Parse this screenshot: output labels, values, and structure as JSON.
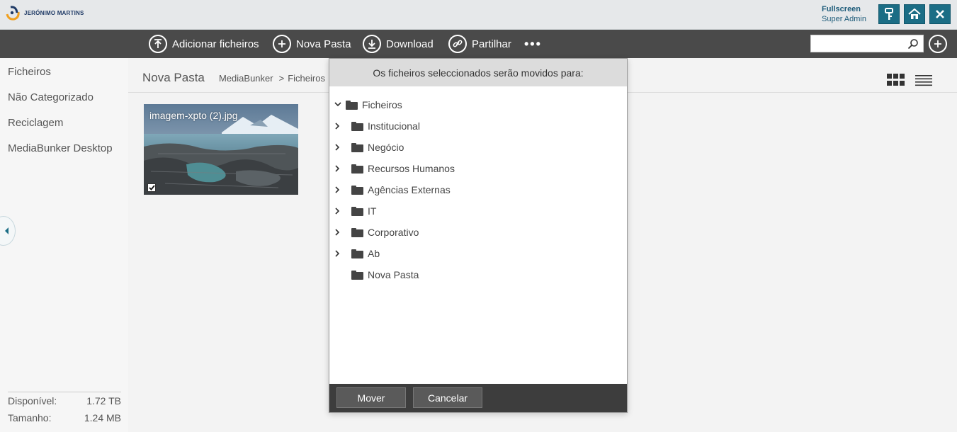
{
  "header": {
    "logo_text": "JERÓNIMO MARTINS",
    "user_mode": "Fullscreen",
    "user_role": "Super Admin"
  },
  "toolbar": {
    "add_files": "Adicionar ficheiros",
    "new_folder": "Nova Pasta",
    "download": "Download",
    "share": "Partilhar",
    "more": "•••",
    "search_value": ""
  },
  "sidebar": {
    "items": [
      {
        "label": "Ficheiros"
      },
      {
        "label": "Não Categorizado"
      },
      {
        "label": "Reciclagem"
      },
      {
        "label": "MediaBunker Desktop"
      }
    ],
    "stats": {
      "available_label": "Disponível:",
      "available_value": "1.72 TB",
      "size_label": "Tamanho:",
      "size_value": "1.24 MB"
    }
  },
  "main": {
    "title": "Nova Pasta",
    "breadcrumb": [
      "MediaBunker",
      ">",
      "Ficheiros"
    ],
    "file": {
      "name": "imagem-xpto (2).jpg",
      "selected": true
    }
  },
  "dialog": {
    "header": "Os ficheiros seleccionados serão movidos para:",
    "root": "Ficheiros",
    "folders": [
      {
        "label": "Institucional",
        "expandable": true
      },
      {
        "label": "Negócio",
        "expandable": true
      },
      {
        "label": "Recursos Humanos",
        "expandable": true
      },
      {
        "label": "Agências Externas",
        "expandable": true
      },
      {
        "label": "IT",
        "expandable": true
      },
      {
        "label": "Corporativo",
        "expandable": true
      },
      {
        "label": "Ab",
        "expandable": true
      },
      {
        "label": "Nova Pasta",
        "expandable": false
      }
    ],
    "move_label": "Mover",
    "cancel_label": "Cancelar"
  },
  "colors": {
    "accent": "#1b6d85",
    "toolbar_bg": "#4a4a4a",
    "dialog_footer": "#3d3d3d"
  }
}
